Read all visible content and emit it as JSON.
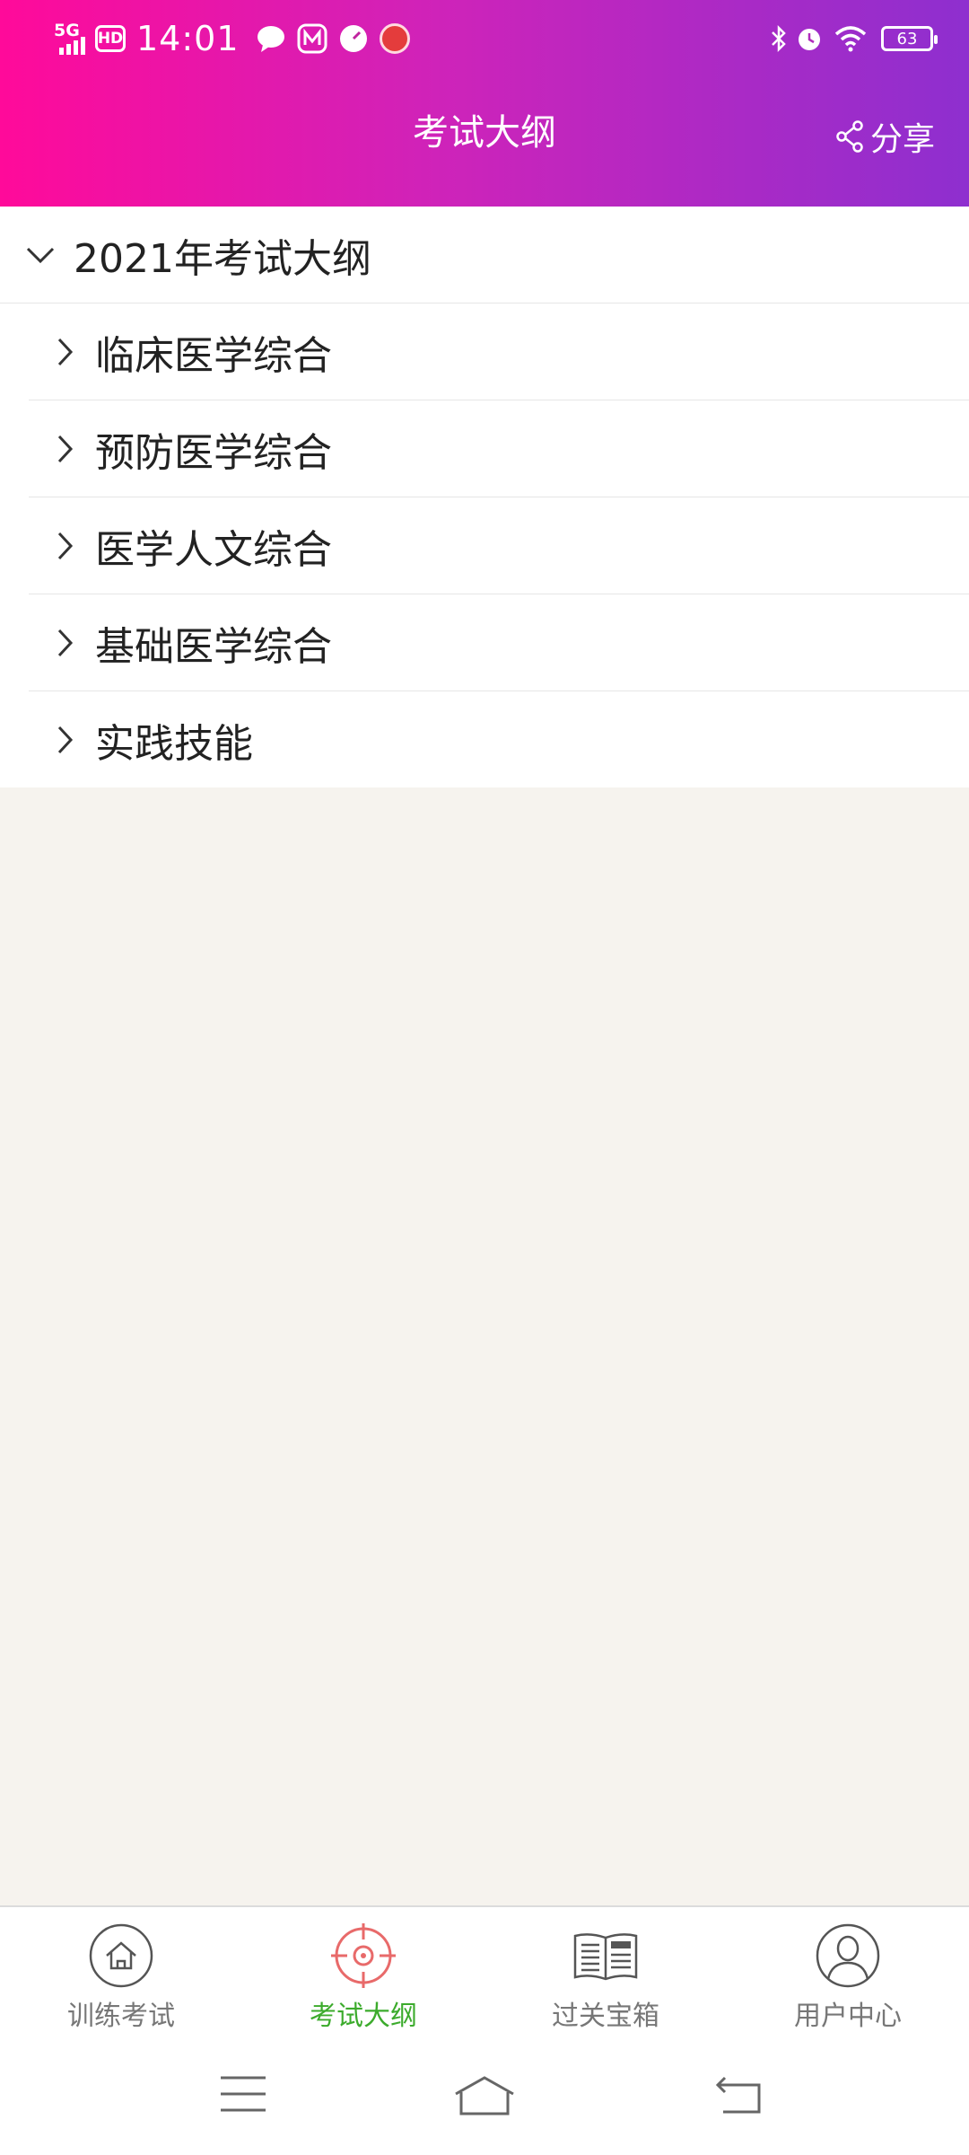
{
  "status_bar": {
    "network": "5G",
    "hd": "HD",
    "time": "14:01",
    "battery": "63"
  },
  "header": {
    "title": "考试大纲",
    "share_label": "分享"
  },
  "outline": {
    "group_label": "2021年考试大纲",
    "items": [
      {
        "label": "临床医学综合"
      },
      {
        "label": "预防医学综合"
      },
      {
        "label": "医学人文综合"
      },
      {
        "label": "基础医学综合"
      },
      {
        "label": "实践技能"
      }
    ]
  },
  "bottom_nav": {
    "tabs": [
      {
        "label": "训练考试",
        "icon": "home-icon"
      },
      {
        "label": "考试大纲",
        "icon": "target-icon",
        "active": true
      },
      {
        "label": "过关宝箱",
        "icon": "news-icon"
      },
      {
        "label": "用户中心",
        "icon": "user-icon"
      }
    ]
  },
  "colors": {
    "header_gradient_start": "#ff0a9a",
    "header_gradient_end": "#8e2fcf",
    "active_tab": "#3cab2c",
    "active_icon": "#e86a6a",
    "background": "#f6f3ee"
  }
}
